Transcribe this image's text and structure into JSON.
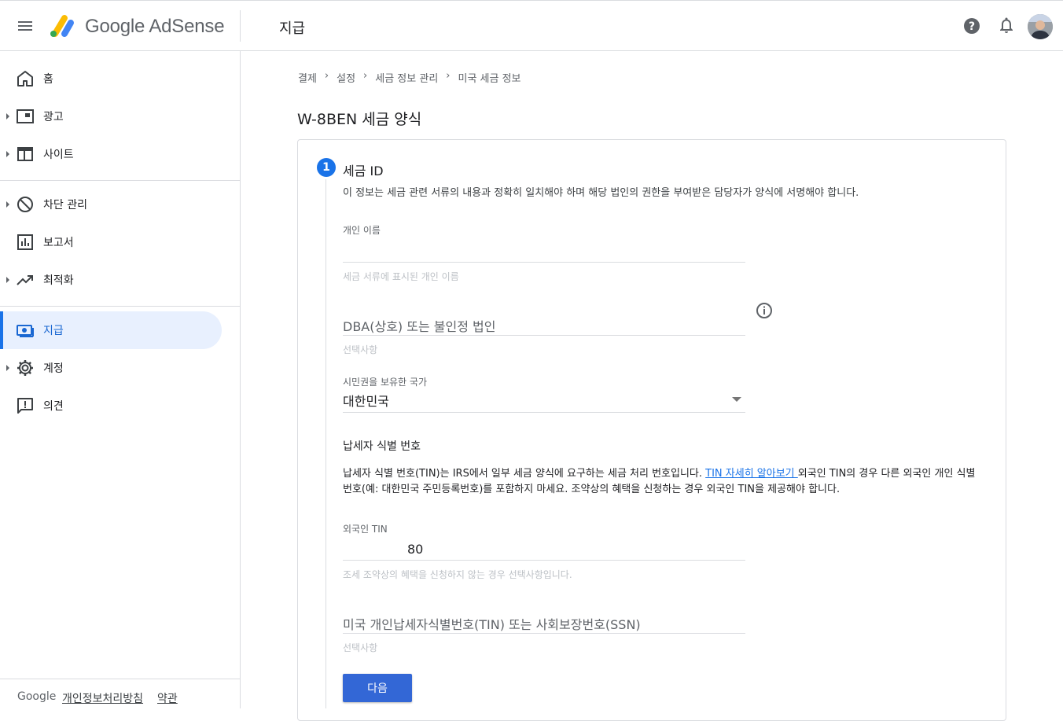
{
  "header": {
    "brand": "Google AdSense",
    "page_name": "지급",
    "menu_icon": "menu-icon",
    "help_icon": "help-icon",
    "notifications_icon": "bell-icon",
    "avatar_icon": "avatar"
  },
  "sidebar": {
    "items": [
      {
        "label": "홈",
        "icon": "home-icon",
        "expandable": false
      },
      {
        "label": "광고",
        "icon": "ads-icon",
        "expandable": true
      },
      {
        "label": "사이트",
        "icon": "sites-icon",
        "expandable": true
      },
      {
        "label": "차단 관리",
        "icon": "block-icon",
        "expandable": true
      },
      {
        "label": "보고서",
        "icon": "reports-icon",
        "expandable": false
      },
      {
        "label": "최적화",
        "icon": "optimization-icon",
        "expandable": true
      },
      {
        "label": "지급",
        "icon": "payments-icon",
        "expandable": false,
        "active": true
      },
      {
        "label": "계정",
        "icon": "gear-icon",
        "expandable": true
      },
      {
        "label": "의견",
        "icon": "feedback-icon",
        "expandable": false
      }
    ],
    "footer": {
      "google": "Google",
      "privacy": "개인정보처리방침",
      "terms": "약관"
    }
  },
  "breadcrumb": [
    "결제",
    "설정",
    "세금 정보 관리",
    "미국 세금 정보"
  ],
  "page_title": "W-8BEN 세금 양식",
  "step": {
    "number": "1",
    "title": "세금 ID",
    "description": "이 정보는 세금 관련 서류의 내용과 정확히 일치해야 하며 해당 법인의 권한을 부여받은 담당자가 양식에 서명해야 합니다."
  },
  "form": {
    "individual_name": {
      "label": "개인 이름",
      "value": "",
      "hint": "세금 서류에 표시된 개인 이름"
    },
    "dba": {
      "placeholder": "DBA(상호) 또는 불인정 법인",
      "hint": "선택사항"
    },
    "citizenship": {
      "label": "시민권을 보유한 국가",
      "value": "대한민국"
    },
    "tin_section": {
      "title": "납세자 식별 번호",
      "paragraph_before": "납세자 식별 번호(TIN)는 IRS에서 일부 세금 양식에 요구하는 세금 처리 번호입니다. ",
      "link": "TIN 자세히 알아보기 ",
      "paragraph_after": "외국인 TIN의 경우 다른 외국인 개인 식별 번호(예: 대한민국 주민등록번호)를 포함하지 마세요. 조약상의 혜택을 신청하는 경우 외국인 TIN을 제공해야 합니다."
    },
    "foreign_tin": {
      "label": "외국인 TIN",
      "visible_value": "80",
      "hint": "조세 조약상의 혜택을 신청하지 않는 경우 선택사항입니다."
    },
    "us_tin": {
      "placeholder": "미국 개인납세자식별번호(TIN) 또는 사회보장번호(SSN)",
      "hint": "선택사항"
    },
    "next_button": "다음"
  },
  "colors": {
    "accent": "#1a73e8",
    "button": "#3367d6",
    "active_nav_bg": "#e8f0fe"
  }
}
